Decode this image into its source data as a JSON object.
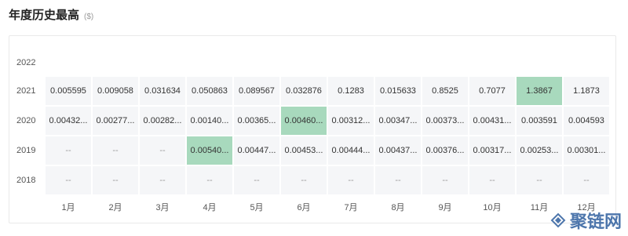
{
  "header": {
    "title": "年度历史最高",
    "unit": "($)"
  },
  "years": [
    "2022",
    "2021",
    "2020",
    "2019",
    "2018"
  ],
  "months": [
    "1月",
    "2月",
    "3月",
    "4月",
    "5月",
    "6月",
    "7月",
    "8月",
    "9月",
    "10月",
    "11月",
    "12月"
  ],
  "rows": [
    [
      "",
      "",
      "",
      "",
      "",
      "",
      "",
      "",
      "",
      "",
      "",
      ""
    ],
    [
      "0.005595",
      "0.009058",
      "0.031634",
      "0.050863",
      "0.089567",
      "0.032876",
      "0.1283",
      "0.015633",
      "0.8525",
      "0.7077",
      "1.3867",
      "1.1873"
    ],
    [
      "0.00432...",
      "0.00277...",
      "0.00282...",
      "0.00140...",
      "0.00365...",
      "0.00460...",
      "0.00312...",
      "0.00347...",
      "0.00373...",
      "0.00431...",
      "0.003591",
      "0.004593"
    ],
    [
      "--",
      "--",
      "--",
      "0.00540...",
      "0.00447...",
      "0.00453...",
      "0.00444...",
      "0.00437...",
      "0.00376...",
      "0.00317...",
      "0.00253...",
      "0.00301..."
    ],
    [
      "--",
      "--",
      "--",
      "--",
      "--",
      "--",
      "--",
      "--",
      "--",
      "--",
      "--",
      "--"
    ]
  ],
  "highlights": [
    [
      1,
      10
    ],
    [
      2,
      5
    ],
    [
      3,
      3
    ]
  ],
  "colors": {
    "highlight": "#a8d9bd",
    "cell": "#f5f6f8"
  },
  "watermark": {
    "text": "聚链网",
    "icon": "chain-logo-icon"
  }
}
